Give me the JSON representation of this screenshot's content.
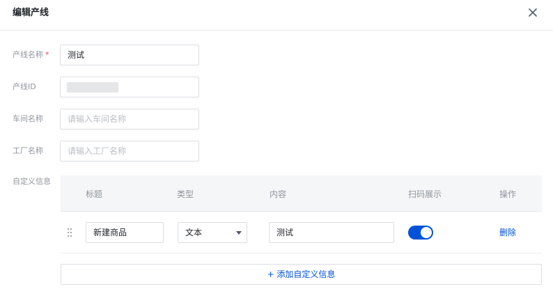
{
  "dialog": {
    "title": "编辑产线",
    "close_icon": "close-icon"
  },
  "form": {
    "line_name": {
      "label": "产线名称",
      "required_mark": "*",
      "value": "测试"
    },
    "line_id": {
      "label": "产线ID"
    },
    "workshop": {
      "label": "车间名称",
      "placeholder": "请输入车间名称"
    },
    "factory": {
      "label": "工厂名称",
      "placeholder": "请输入工厂名称"
    },
    "custom_info": {
      "label": "自定义信息",
      "columns": [
        "标题",
        "类型",
        "内容",
        "扫码展示",
        "操作"
      ],
      "rows": [
        {
          "drag_icon": "drag-handle-icon",
          "title": "新建商品",
          "type": "文本",
          "content": "测试",
          "scan_display": true,
          "action": "删除"
        }
      ],
      "add_label": "+ 添加自定义信息"
    }
  },
  "colors": {
    "accent": "#0052d9",
    "required": "#e34d59",
    "label": "#8f959e",
    "border": "#dcdee3"
  }
}
